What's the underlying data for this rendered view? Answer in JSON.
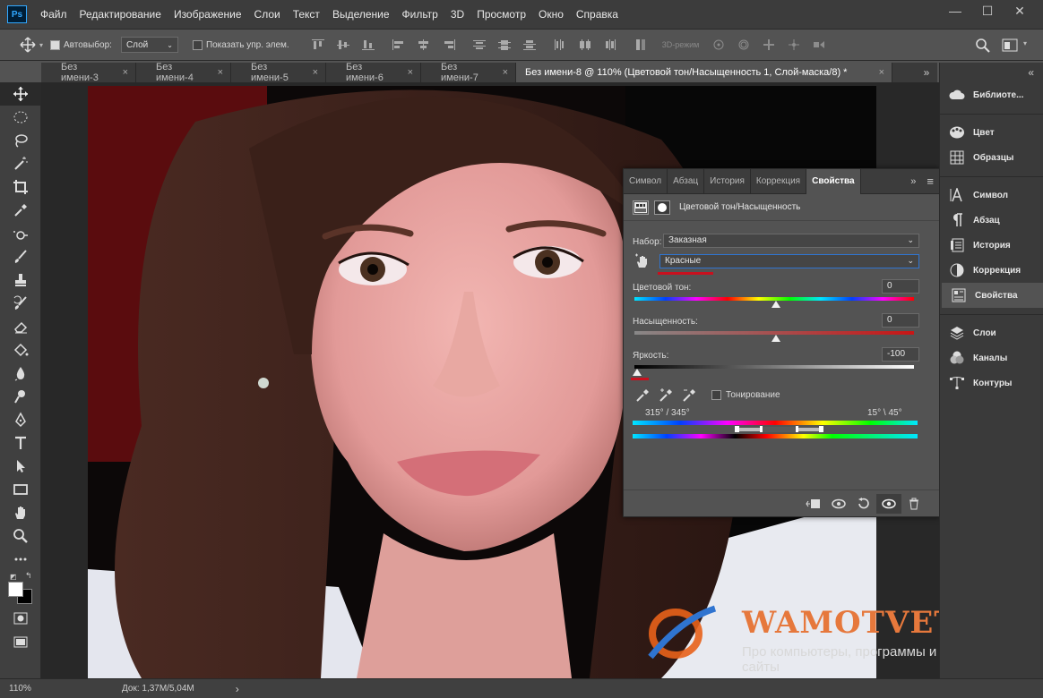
{
  "menubar": {
    "logo": "Ps",
    "items": [
      "Файл",
      "Редактирование",
      "Изображение",
      "Слои",
      "Текст",
      "Выделение",
      "Фильтр",
      "3D",
      "Просмотр",
      "Окно",
      "Справка"
    ],
    "win_min": "—",
    "win_max": "☐",
    "win_close": "✕"
  },
  "options": {
    "auto_select_label": "Автовыбор:",
    "auto_select_value": "Слой",
    "show_transform_label": "Показать упр. элем.",
    "mode_3d_label": "3D-режим"
  },
  "tabs": [
    {
      "label": "Без имени-3"
    },
    {
      "label": "Без имени-4"
    },
    {
      "label": "Без имени-5"
    },
    {
      "label": "Без имени-6"
    },
    {
      "label": "Без имени-7"
    },
    {
      "label": "Без имени-8 @ 110% (Цветовой тон/Насыщенность 1, Слой-маска/8) *"
    }
  ],
  "tab_close": "×",
  "tabs_overflow": "»",
  "status": {
    "zoom": "110%",
    "doc": "Док: 1,37M/5,04M",
    "arrow": "›"
  },
  "right_panel": {
    "collapse": "«",
    "items": [
      {
        "label": "Библиоте...",
        "icon": "cloud-libraries-icon"
      },
      {
        "label": "Цвет",
        "icon": "palette-icon"
      },
      {
        "label": "Образцы",
        "icon": "swatches-grid-icon"
      },
      {
        "label": "Символ",
        "icon": "text-character-icon"
      },
      {
        "label": "Абзац",
        "icon": "paragraph-icon"
      },
      {
        "label": "История",
        "icon": "history-icon"
      },
      {
        "label": "Коррекция",
        "icon": "adjustments-icon"
      },
      {
        "label": "Свойства",
        "icon": "properties-icon"
      },
      {
        "label": "Слои",
        "icon": "layers-icon"
      },
      {
        "label": "Каналы",
        "icon": "channels-icon"
      },
      {
        "label": "Контуры",
        "icon": "paths-icon"
      }
    ]
  },
  "properties": {
    "tabs": [
      "Символ",
      "Абзац",
      "История",
      "Коррекция",
      "Свойства"
    ],
    "active_tab": "Свойства",
    "panel_menu": "≡",
    "panel_expand": "»",
    "title": "Цветовой тон/Насыщенность",
    "preset_label": "Набор:",
    "preset_value": "Заказная",
    "channel_value": "Красные",
    "hue_label": "Цветовой тон:",
    "hue_value": "0",
    "saturation_label": "Насыщенность:",
    "saturation_value": "0",
    "lightness_label": "Яркость:",
    "lightness_value": "-100",
    "colorize_label": "Тонирование",
    "range_left": "315° / 345°",
    "range_right": "15° \\ 45°"
  },
  "watermark": {
    "title": "WAMOTVET.RU",
    "subtitle": "Про компьютеры, программы и сайты"
  },
  "colors": {
    "ui_dark": "#3c3c3c",
    "ui_mid": "#535353",
    "accent_red": "#c8101e",
    "ps_blue": "#31a8ff"
  }
}
